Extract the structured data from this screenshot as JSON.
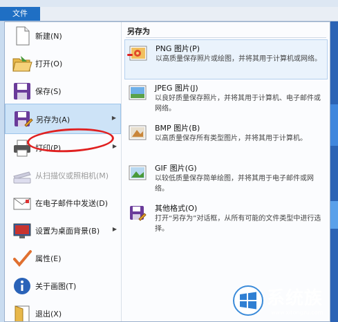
{
  "file_tab": "文件",
  "left_menu": [
    {
      "label": "新建(N)",
      "icon": "new-document-icon",
      "disabled": false,
      "arrow": false
    },
    {
      "label": "打开(O)",
      "icon": "open-folder-icon",
      "disabled": false,
      "arrow": false
    },
    {
      "label": "保存(S)",
      "icon": "save-floppy-icon",
      "disabled": false,
      "arrow": false
    },
    {
      "label": "另存为(A)",
      "icon": "save-as-icon",
      "disabled": false,
      "arrow": true
    },
    {
      "label": "打印(P)",
      "icon": "printer-icon",
      "disabled": false,
      "arrow": true
    },
    {
      "label": "从扫描仪或照相机(M)",
      "icon": "scanner-icon",
      "disabled": true,
      "arrow": false
    },
    {
      "label": "在电子邮件中发送(D)",
      "icon": "email-icon",
      "disabled": false,
      "arrow": false
    },
    {
      "label": "设置为桌面背景(B)",
      "icon": "desktop-background-icon",
      "disabled": false,
      "arrow": true
    },
    {
      "label": "属性(E)",
      "icon": "checkmark-icon",
      "disabled": false,
      "arrow": false
    },
    {
      "label": "关于画图(T)",
      "icon": "info-icon",
      "disabled": false,
      "arrow": false
    },
    {
      "label": "退出(X)",
      "icon": "exit-icon",
      "disabled": false,
      "arrow": false
    }
  ],
  "submenu": {
    "heading": "另存为",
    "items": [
      {
        "title": "PNG 图片(P)",
        "desc": "以高质量保存照片或绘图，并将其用于计算机或网络。",
        "icon": "png-image-icon"
      },
      {
        "title": "JPEG 图片(J)",
        "desc": "以良好质量保存照片，并将其用于计算机、电子邮件或网络。",
        "icon": "jpeg-image-icon"
      },
      {
        "title": "BMP 图片(B)",
        "desc": "以高质量保存所有类型图片，并将其用于计算机。",
        "icon": "bmp-image-icon"
      },
      {
        "title": "GIF 图片(G)",
        "desc": "以较低质量保存简单绘图，并将其用于电子邮件或网络。",
        "icon": "gif-image-icon"
      },
      {
        "title": "其他格式(O)",
        "desc": "打开“另存为”对话框，从所有可能的文件类型中进行选择。",
        "icon": "other-formats-icon"
      }
    ]
  },
  "watermark": {
    "text": "系统族",
    "url": "www.xitongzu.com"
  },
  "colors": {
    "accent": "#1f6fc4",
    "highlight": "#cde3f7",
    "annotation_red": "#e02020"
  }
}
